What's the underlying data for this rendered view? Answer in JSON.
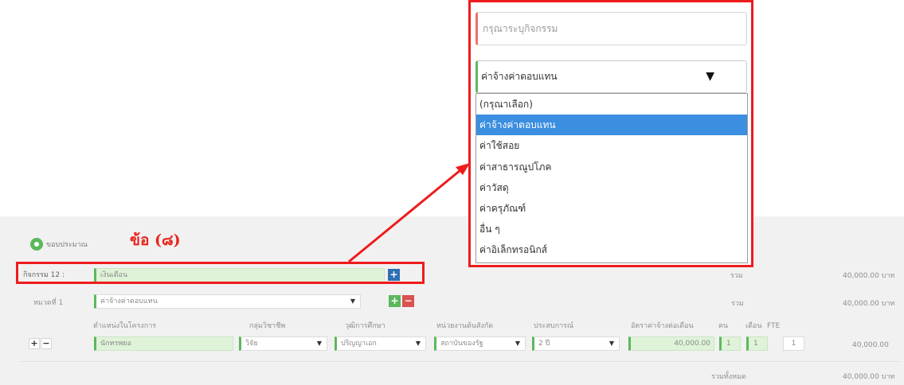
{
  "colors": {
    "highlight_red": "#ee1c1c",
    "accent_green": "#5cb85c",
    "selected_blue": "#3b8ee0",
    "add_blue": "#2f6fb5",
    "remove_red": "#d9534f"
  },
  "annotation": {
    "label": "ข้อ (๘)"
  },
  "form": {
    "add_activity_label": "ขอบประมาณ",
    "activity_label": "กิจกรรม 12 :",
    "activity_value": "เงินเดือน",
    "category_label": "หมวดที่ 1",
    "category_value": "ค่าจ้างค่าตอบแทน",
    "row_labels": {
      "col1": "ตำแหน่งในโครงการ",
      "col2": "กลุ่มวิชาชีพ",
      "col3": "วุฒิการศึกษา",
      "col4": "หน่วยงานต้นสังกัด",
      "col5": "ประสบการณ์",
      "col6": "อัตราค่าจ้างต่อเดือน",
      "col7": "คน",
      "col8": "เดือน",
      "col9": "FTE"
    },
    "row_values": {
      "position": "นักทรพยอ",
      "profession": "วิจัย",
      "education": "ปริญญาเอก",
      "agency": "สถาบันของรัฐ",
      "experience": "2 ปี",
      "salary": "40,000.00",
      "people": "1",
      "months": "1",
      "fte": "1",
      "amount": "40,000.00"
    },
    "sum_label_1": "รวม",
    "sum_value_1": "40,000.00 บาท",
    "sum_label_2": "รวม",
    "sum_value_2": "40,000.00 บาท",
    "total_label": "รวมทั้งหมด",
    "total_value": "40,000.00 บาท"
  },
  "popup": {
    "activity_placeholder": "กรุณาระบุกิจกรรม",
    "selected_value": "ค่าจ้างค่าตอบแทน",
    "options": [
      "(กรุณาเลือก)",
      "ค่าจ้างค่าตอบแทน",
      "ค่าใช้สอย",
      "ค่าสาธารณูปโภค",
      "ค่าวัสดุ",
      "ค่าครุภัณฑ์",
      "อื่น ๆ",
      "ค่าอิเล็กทรอนิกส์"
    ],
    "selected_index": 1
  },
  "icons": {
    "add": "plus-icon",
    "remove": "minus-icon",
    "dropdown": "caret-down-icon",
    "arrow": "red-arrow"
  }
}
